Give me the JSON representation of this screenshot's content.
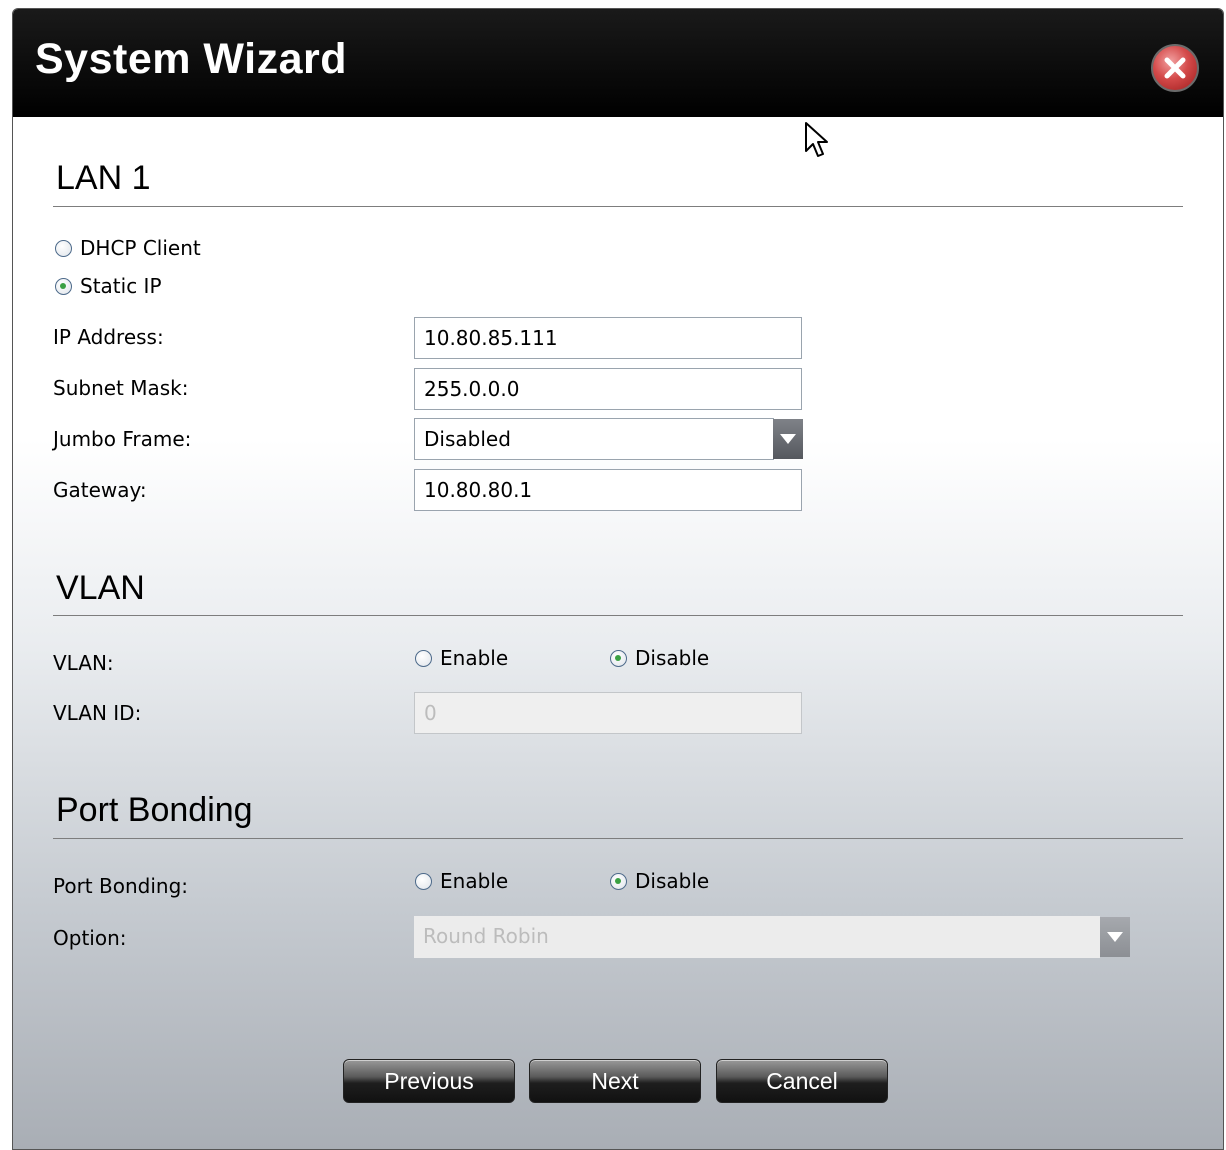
{
  "window": {
    "title": "System Wizard"
  },
  "lan": {
    "heading": "LAN 1",
    "mode_options": [
      {
        "label": "DHCP Client",
        "checked": false
      },
      {
        "label": "Static IP",
        "checked": true
      }
    ],
    "ip_label": "IP Address:",
    "ip_value": "10.80.85.111",
    "subnet_label": "Subnet Mask:",
    "subnet_value": "255.0.0.0",
    "jumbo_label": "Jumbo Frame:",
    "jumbo_value": "Disabled",
    "gateway_label": "Gateway:",
    "gateway_value": "10.80.80.1"
  },
  "vlan": {
    "heading": "VLAN",
    "toggle_label": "VLAN:",
    "enable_label": "Enable",
    "disable_label": "Disable",
    "selected": "Disable",
    "id_label": "VLAN ID:",
    "id_value": "0"
  },
  "bonding": {
    "heading": "Port Bonding",
    "toggle_label": "Port Bonding:",
    "enable_label": "Enable",
    "disable_label": "Disable",
    "selected": "Disable",
    "option_label": "Option:",
    "option_value": "Round Robin"
  },
  "buttons": {
    "previous": "Previous",
    "next": "Next",
    "cancel": "Cancel"
  },
  "colors": {
    "titlebar": "#000000",
    "close_button": "#d44a4a",
    "radio_checked": "#3aa043"
  }
}
